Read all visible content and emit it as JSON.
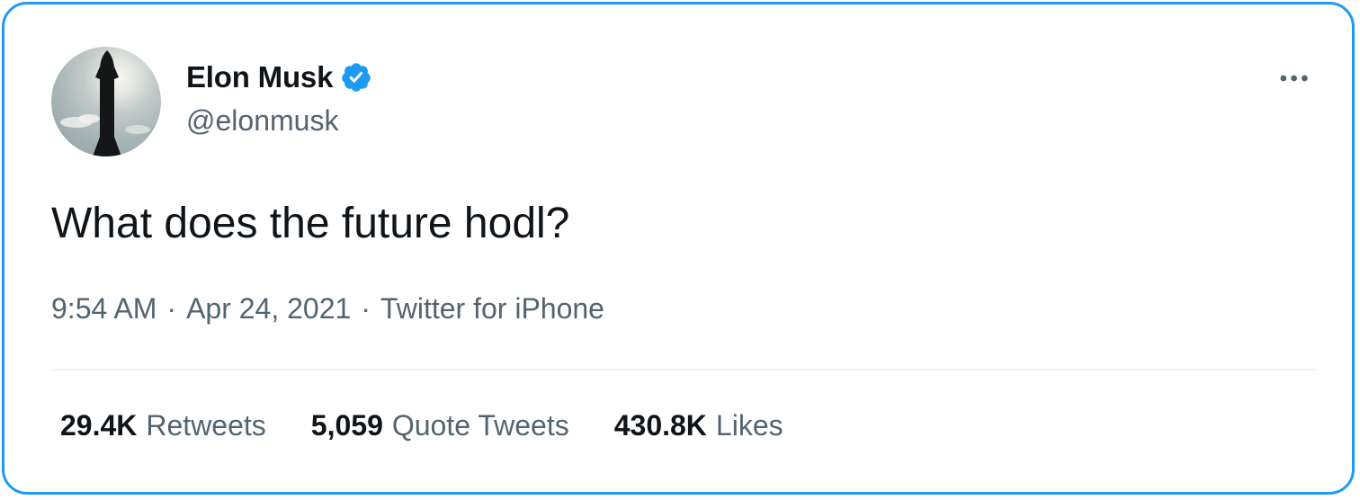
{
  "colors": {
    "border": "#1d9bf0",
    "verified_badge": "#1d9bf0",
    "primary_text": "#0f1419",
    "secondary_text": "#536471",
    "divider": "#eff3f4"
  },
  "author": {
    "display_name": "Elon Musk",
    "handle": "@elonmusk",
    "avatar_icon": "starship-rocket-avatar",
    "verified_icon": "verified-badge-icon"
  },
  "tweet": {
    "text": "What does the future hodl?",
    "time": "9:54 AM",
    "date": "Apr 24, 2021",
    "source": "Twitter for iPhone",
    "separator": "·"
  },
  "menu": {
    "more_icon": "more-dots-icon"
  },
  "stats": [
    {
      "count": "29.4K",
      "label": "Retweets"
    },
    {
      "count": "5,059",
      "label": "Quote Tweets"
    },
    {
      "count": "430.8K",
      "label": "Likes"
    }
  ]
}
